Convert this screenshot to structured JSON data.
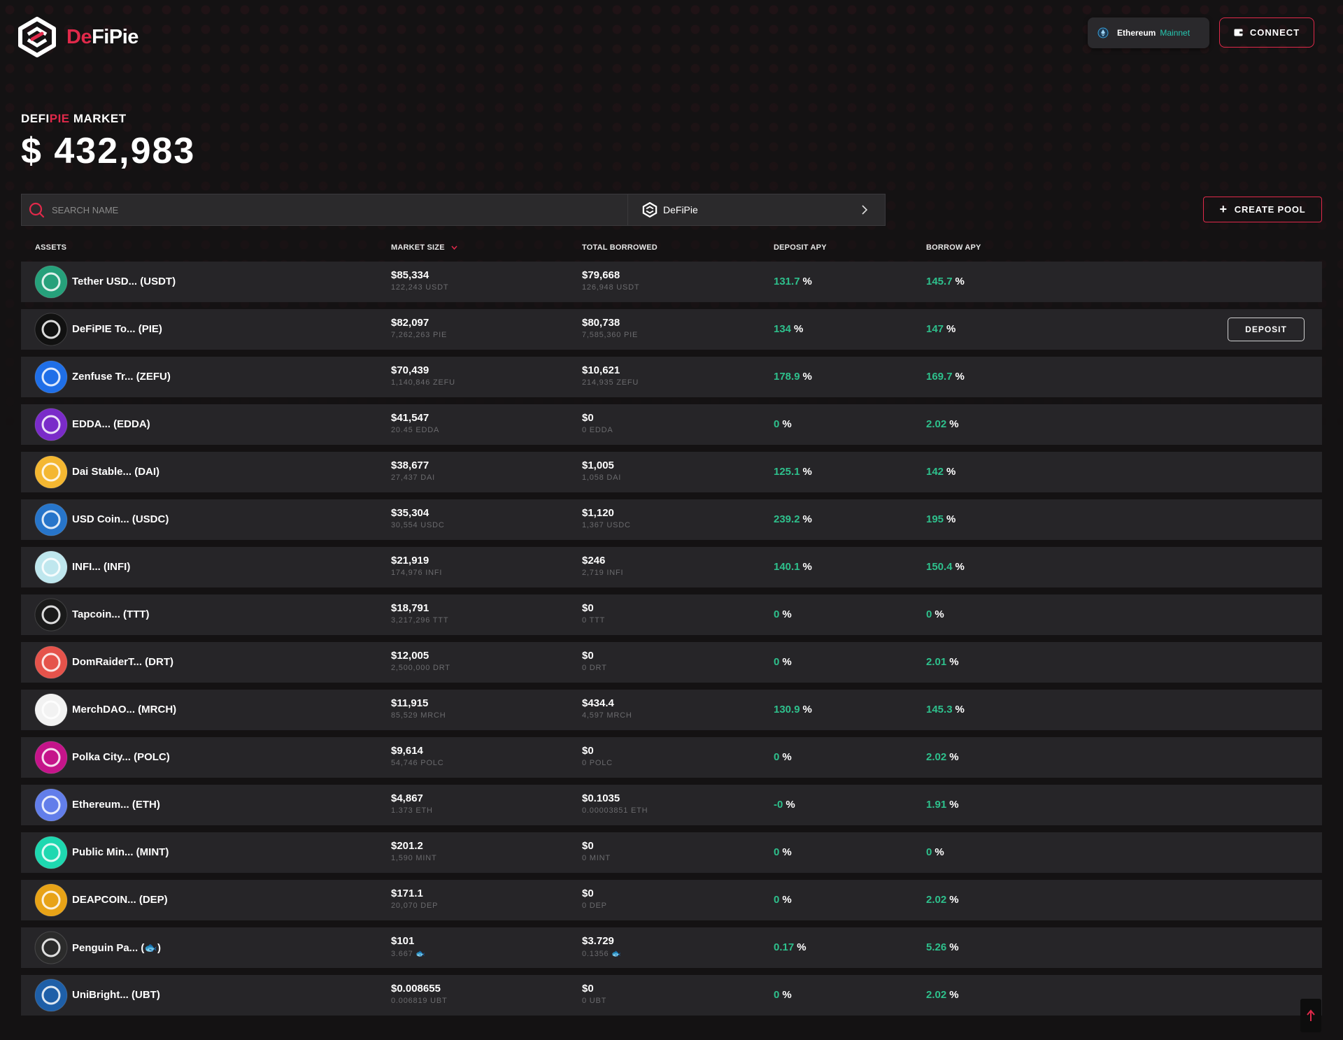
{
  "brand": {
    "prefix": "De",
    "suffix": "FiPie"
  },
  "network": {
    "name": "Ethereum",
    "sub": "Mainnet"
  },
  "connect_label": "CONNECT",
  "market": {
    "title_a": "DEFI",
    "title_b": "PIE",
    "title_c": " MARKET",
    "value": "$ 432,983"
  },
  "search": {
    "placeholder": "SEARCH NAME"
  },
  "pool_selector": {
    "label": "DeFiPie"
  },
  "create_pool_label": "CREATE POOL",
  "columns": {
    "assets": "ASSETS",
    "market_size": "MARKET SIZE",
    "total_borrowed": "TOTAL BORROWED",
    "deposit_apy": "DEPOSIT APY",
    "borrow_apy": "BORROW APY"
  },
  "deposit_label": "DEPOSIT",
  "assets": [
    {
      "name": "Tether USD... (USDT)",
      "icon": "tether-icon",
      "color": "#26a17b",
      "market_size": "$85,334",
      "market_size_sub": "122,243 USDT",
      "borrowed": "$79,668",
      "borrowed_sub": "126,948 USDT",
      "deposit_apy": "131.7",
      "borrow_apy": "145.7"
    },
    {
      "name": "DeFiPIE To... (PIE)",
      "icon": "defipie-icon",
      "color": "#111111",
      "market_size": "$82,097",
      "market_size_sub": "7,262,263 PIE",
      "borrowed": "$80,738",
      "borrowed_sub": "7,585,360 PIE",
      "deposit_apy": "134",
      "borrow_apy": "147"
    },
    {
      "name": "Zenfuse Tr... (ZEFU)",
      "icon": "zenfuse-icon",
      "color": "#1f6fe8",
      "market_size": "$70,439",
      "market_size_sub": "1,140,846 ZEFU",
      "borrowed": "$10,621",
      "borrowed_sub": "214,935 ZEFU",
      "deposit_apy": "178.9",
      "borrow_apy": "169.7"
    },
    {
      "name": "EDDA... (EDDA)",
      "icon": "edda-icon",
      "color": "#7a2bc9",
      "market_size": "$41,547",
      "market_size_sub": "20.45 EDDA",
      "borrowed": "$0",
      "borrowed_sub": "0 EDDA",
      "deposit_apy": "0",
      "borrow_apy": "2.02"
    },
    {
      "name": "Dai Stable... (DAI)",
      "icon": "dai-icon",
      "color": "#f4b731",
      "market_size": "$38,677",
      "market_size_sub": "27,437 DAI",
      "borrowed": "$1,005",
      "borrowed_sub": "1,058 DAI",
      "deposit_apy": "125.1",
      "borrow_apy": "142"
    },
    {
      "name": "USD Coin... (USDC)",
      "icon": "usdc-icon",
      "color": "#2775ca",
      "market_size": "$35,304",
      "market_size_sub": "30,554 USDC",
      "borrowed": "$1,120",
      "borrowed_sub": "1,367 USDC",
      "deposit_apy": "239.2",
      "borrow_apy": "195"
    },
    {
      "name": "INFI... (INFI)",
      "icon": "infi-icon",
      "color": "#bfe7ee",
      "market_size": "$21,919",
      "market_size_sub": "174,976 INFI",
      "borrowed": "$246",
      "borrowed_sub": "2,719 INFI",
      "deposit_apy": "140.1",
      "borrow_apy": "150.4"
    },
    {
      "name": "Tapcoin... (TTT)",
      "icon": "tapcoin-icon",
      "color": "#1a1a1a",
      "market_size": "$18,791",
      "market_size_sub": "3,217,296 TTT",
      "borrowed": "$0",
      "borrowed_sub": "0 TTT",
      "deposit_apy": "0",
      "borrow_apy": "0"
    },
    {
      "name": "DomRaiderT... (DRT)",
      "icon": "domraider-icon",
      "color": "#e5534b",
      "market_size": "$12,005",
      "market_size_sub": "2,500,000 DRT",
      "borrowed": "$0",
      "borrowed_sub": "0 DRT",
      "deposit_apy": "0",
      "borrow_apy": "2.01"
    },
    {
      "name": "MerchDAO... (MRCH)",
      "icon": "merchdao-icon",
      "color": "#f2f2f2",
      "market_size": "$11,915",
      "market_size_sub": "85,529 MRCH",
      "borrowed": "$434.4",
      "borrowed_sub": "4,597 MRCH",
      "deposit_apy": "130.9",
      "borrow_apy": "145.3"
    },
    {
      "name": "Polka City... (POLC)",
      "icon": "polkacity-icon",
      "color": "#c5148a",
      "market_size": "$9,614",
      "market_size_sub": "54,746 POLC",
      "borrowed": "$0",
      "borrowed_sub": "0 POLC",
      "deposit_apy": "0",
      "borrow_apy": "2.02"
    },
    {
      "name": "Ethereum... (ETH)",
      "icon": "ethereum-icon",
      "color": "#627eea",
      "market_size": "$4,867",
      "market_size_sub": "1.373 ETH",
      "borrowed": "$0.1035",
      "borrowed_sub": "0.00003851 ETH",
      "deposit_apy": "-0",
      "borrow_apy": "1.91"
    },
    {
      "name": "Public Min... (MINT)",
      "icon": "publicmint-icon",
      "color": "#1ed8b0",
      "market_size": "$201.2",
      "market_size_sub": "1,590 MINT",
      "borrowed": "$0",
      "borrowed_sub": "0 MINT",
      "deposit_apy": "0",
      "borrow_apy": "0"
    },
    {
      "name": "DEAPCOIN... (DEP)",
      "icon": "deapcoin-icon",
      "color": "#e8a317",
      "market_size": "$171.1",
      "market_size_sub": "20,070 DEP",
      "borrowed": "$0",
      "borrowed_sub": "0 DEP",
      "deposit_apy": "0",
      "borrow_apy": "2.02"
    },
    {
      "name": "Penguin Pa... (🐟)",
      "icon": "penguin-party-icon",
      "color": "#2b2b2b",
      "market_size": "$101",
      "market_size_sub": "3.667 🐟",
      "borrowed": "$3.729",
      "borrowed_sub": "0.1356 🐟",
      "deposit_apy": "0.17",
      "borrow_apy": "5.26"
    },
    {
      "name": "UniBright... (UBT)",
      "icon": "unibright-icon",
      "color": "#1e5fa8",
      "market_size": "$0.008655",
      "market_size_sub": "0.006819 UBT",
      "borrowed": "$0",
      "borrowed_sub": "0 UBT",
      "deposit_apy": "0",
      "borrow_apy": "2.02"
    }
  ],
  "colors": {
    "accent": "#e0294a",
    "positive": "#2ec08c",
    "network": "#26c6b0",
    "row_bg": "#262528",
    "page_bg": "#141213"
  }
}
